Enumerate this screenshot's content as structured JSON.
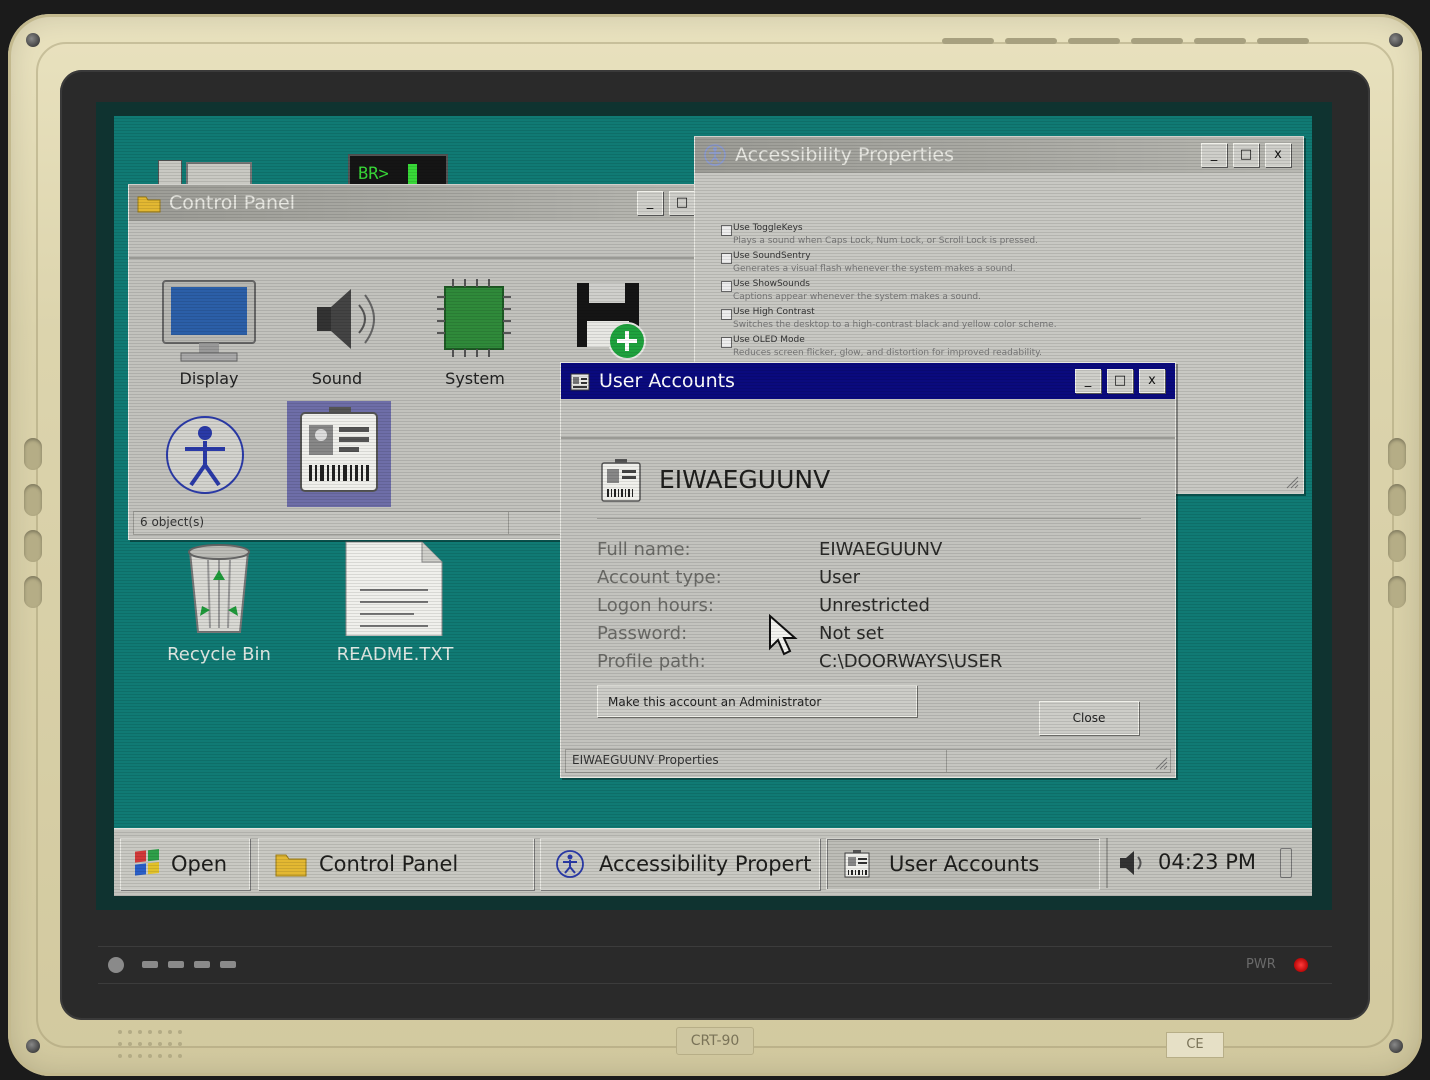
{
  "monitor": {
    "power_label": "PWR",
    "model_label": "CRT-90",
    "cert_label": "CE"
  },
  "desktop": {
    "terminal_icon_text": "BR>",
    "icons": [
      {
        "label": "Recycle Bin"
      },
      {
        "label": "README.TXT"
      }
    ]
  },
  "control_panel": {
    "title": "Control Panel",
    "icons": [
      {
        "label": "Display"
      },
      {
        "label": "Sound"
      },
      {
        "label": "System"
      }
    ],
    "status": "6 object(s)"
  },
  "accessibility": {
    "title": "Accessibility Properties",
    "options": [
      {
        "label": "Use ToggleKeys",
        "desc": "Plays a sound when Caps Lock, Num Lock, or Scroll Lock is pressed.",
        "checked": false
      },
      {
        "label": "Use SoundSentry",
        "desc": "Generates a visual flash whenever the system makes a sound.",
        "checked": false
      },
      {
        "label": "Use ShowSounds",
        "desc": "Captions appear whenever the system makes a sound.",
        "checked": false
      },
      {
        "label": "Use High Contrast",
        "desc": "Switches the desktop to a high-contrast black and yellow color scheme.",
        "checked": false
      },
      {
        "label": "Use OLED Mode",
        "desc": "Reduces screen flicker, glow, and distortion for improved readability.",
        "checked": false
      }
    ]
  },
  "user_accounts": {
    "title": "User Accounts",
    "username": "EIWAEGUUNV",
    "fields": [
      {
        "label": "Full name:",
        "value": "EIWAEGUUNV"
      },
      {
        "label": "Account type:",
        "value": "User"
      },
      {
        "label": "Logon hours:",
        "value": "Unrestricted"
      },
      {
        "label": "Password:",
        "value": "Not set"
      },
      {
        "label": "Profile path:",
        "value": "C:\\DOORWAYS\\USER"
      }
    ],
    "admin_button": "Make this account an Administrator",
    "close_button": "Close",
    "status": "EIWAEGUUNV Properties"
  },
  "taskbar": {
    "start_label": "Open",
    "items": [
      {
        "label": "Control Panel"
      },
      {
        "label": "Accessibility Propert"
      },
      {
        "label": "User Accounts"
      }
    ],
    "clock": "04:23 PM"
  },
  "window_buttons": {
    "minimize": "_",
    "maximize": "□",
    "close": "x"
  }
}
